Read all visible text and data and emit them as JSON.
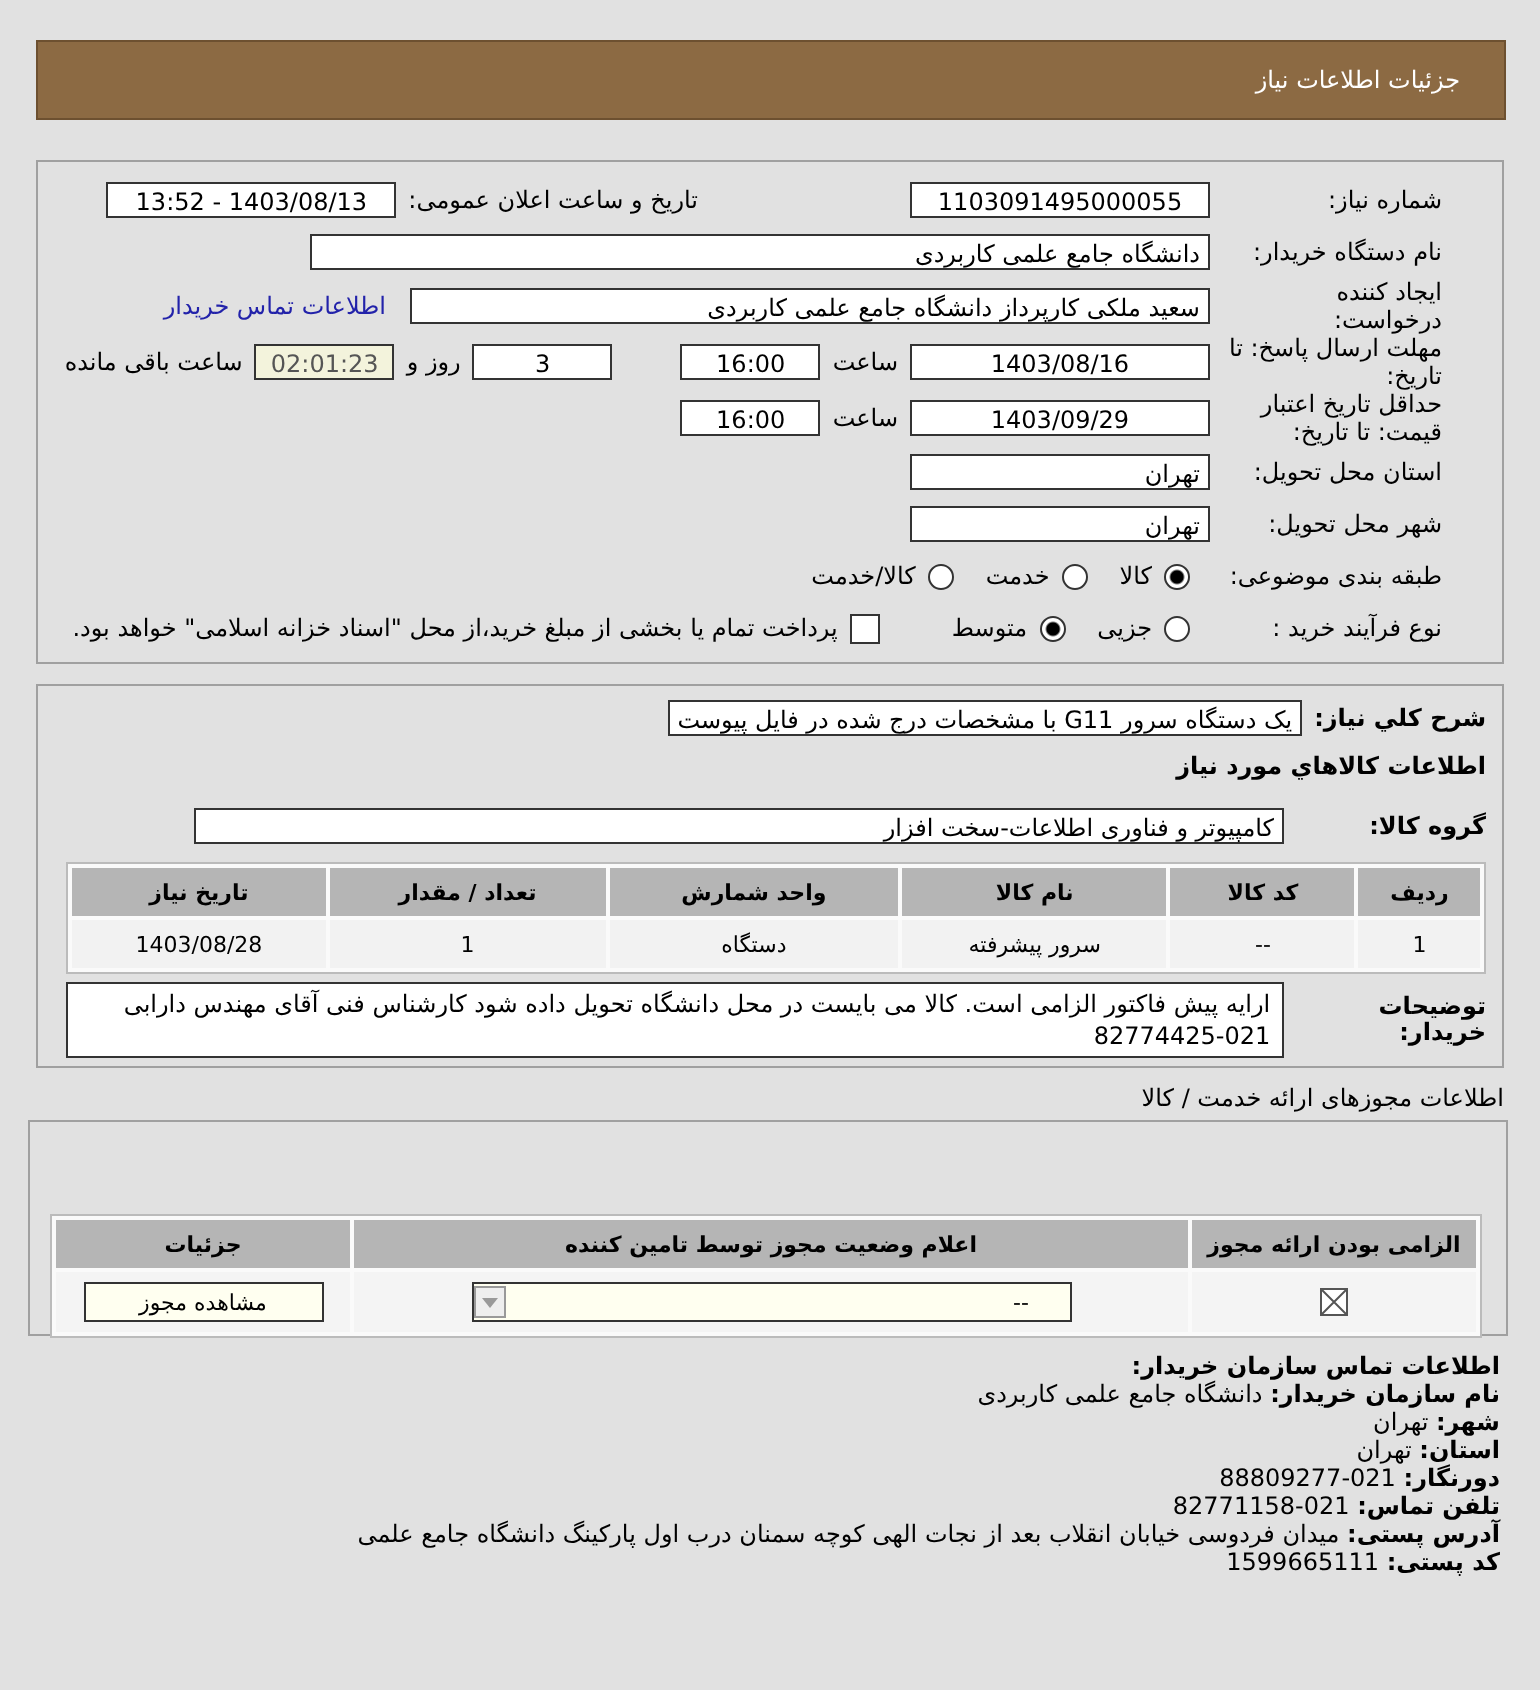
{
  "header": {
    "title": "جزئیات اطلاعات نیاز"
  },
  "need_number": {
    "label": "شماره نیاز:",
    "value": "1103091495000055"
  },
  "announce": {
    "label": "تاریخ و ساعت اعلان عمومی:",
    "value": "1403/08/13 - 13:52"
  },
  "buyer_org": {
    "label": "نام دستگاه خریدار:",
    "value": "دانشگاه جامع علمی کاربردی"
  },
  "requester": {
    "label": "ایجاد کننده درخواست:",
    "value": "سعید ملکی کارپرداز دانشگاه جامع علمی کاربردی",
    "link": "اطلاعات تماس خریدار"
  },
  "deadline": {
    "label": "مهلت ارسال پاسخ: تا تاریخ:",
    "date": "1403/08/16",
    "time_label": "ساعت",
    "time": "16:00",
    "days": "3",
    "days_label": "روز و",
    "remaining": "02:01:23",
    "remaining_label": "ساعت باقی مانده"
  },
  "validity": {
    "label": "حداقل تاریخ اعتبار قیمت: تا تاریخ:",
    "date": "1403/09/29",
    "time_label": "ساعت",
    "time": "16:00"
  },
  "province": {
    "label": "استان محل تحویل:",
    "value": "تهران"
  },
  "city": {
    "label": "شهر محل تحویل:",
    "value": "تهران"
  },
  "category": {
    "label": "طبقه بندی موضوعی:",
    "options": [
      {
        "label": "کالا",
        "selected": true
      },
      {
        "label": "خدمت",
        "selected": false
      },
      {
        "label": "کالا/خدمت",
        "selected": false
      }
    ]
  },
  "purchase_type": {
    "label": "نوع فرآیند خرید :",
    "options": [
      {
        "label": "جزیی",
        "selected": false
      },
      {
        "label": "متوسط",
        "selected": true
      }
    ],
    "payment": {
      "checked": false,
      "label": "پرداخت تمام یا بخشی از مبلغ خرید،از محل \"اسناد خزانه اسلامی\" خواهد بود."
    }
  },
  "description": {
    "label": "شرح کلي نياز:",
    "value": "یک دستگاه سرور G11 با مشخصات درج شده در فایل پیوست"
  },
  "goods_title": "اطلاعات کالاهاي مورد نياز",
  "goods_group": {
    "label": "گروه کالا:",
    "value": "کامپیوتر و فناوری اطلاعات-سخت افزار"
  },
  "goods_table": {
    "columns": [
      "ردیف",
      "کد کالا",
      "نام کالا",
      "واحد شمارش",
      "تعداد / مقدار",
      "تاریخ نیاز"
    ],
    "rows": [
      [
        "1",
        "--",
        "سرور پیشرفته",
        "دستگاه",
        "1",
        "1403/08/28"
      ]
    ]
  },
  "buyer_notes": {
    "label": "توضیحات خریدار:",
    "value": "ارایه پیش فاکتور الزامی است. کالا می بایست در محل دانشگاه تحویل داده شود کارشناس فنی آقای مهندس دارابی 021-82774425"
  },
  "permits": {
    "title": "اطلاعات مجوزهای ارائه خدمت / کالا",
    "columns": [
      "الزامی بودن ارائه مجوز",
      "اعلام وضعیت مجوز توسط تامین کننده",
      "جزئیات"
    ],
    "rows": [
      {
        "required": true,
        "status": "--",
        "button": "مشاهده مجوز"
      }
    ]
  },
  "contact": {
    "title": "اطلاعات تماس سازمان خریدار:",
    "lines": [
      {
        "label": "نام سازمان خریدار:",
        "value": "دانشگاه جامع علمی کاربردی"
      },
      {
        "label": "شهر:",
        "value": "تهران"
      },
      {
        "label": "استان:",
        "value": "تهران"
      },
      {
        "label": "دورنگار:",
        "value": "021-88809277"
      },
      {
        "label": "تلفن تماس:",
        "value": "021-82771158"
      },
      {
        "label": "آدرس پستی:",
        "value": "میدان فردوسی خیابان انقلاب بعد از نجات الهی کوچه سمنان درب اول پارکینگ دانشگاه جامع علمی"
      },
      {
        "label": "کد پستی:",
        "value": "1599665111"
      }
    ]
  }
}
